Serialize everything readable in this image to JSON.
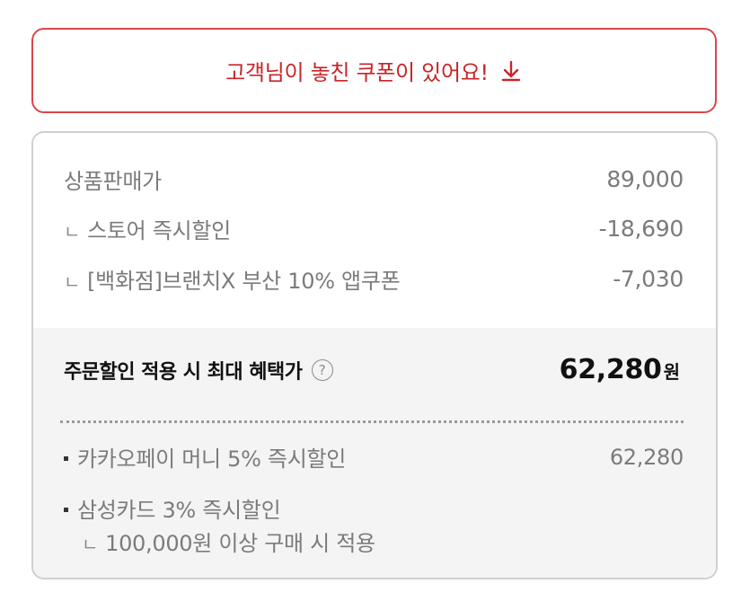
{
  "coupon_banner": {
    "text": "고객님이 놓친 쿠폰이 있어요!",
    "icon": "download-arrow-icon",
    "accent_color": "#c8252a"
  },
  "price_summary": {
    "items": [
      {
        "prefix": "",
        "label": "상품판매가",
        "value": "89,000"
      },
      {
        "prefix": "ㄴ",
        "label": "스토어 즉시할인",
        "value": "-18,690"
      },
      {
        "prefix": "ㄴ",
        "label": "[백화점]브랜치X 부산 10% 앱쿠폰",
        "value": "-7,030"
      }
    ],
    "total": {
      "label": "주문할인 적용 시 최대 혜택가",
      "help_symbol": "?",
      "amount": "62,280",
      "unit": "원"
    },
    "payment_benefits": [
      {
        "label": "카카오페이 머니 5% 즉시할인",
        "value": "62,280"
      },
      {
        "label": "삼성카드 3% 즉시할인",
        "value": "",
        "sub_prefix": "ㄴ",
        "sub_label": "100,000원 이상 구매 시 적용"
      }
    ]
  }
}
